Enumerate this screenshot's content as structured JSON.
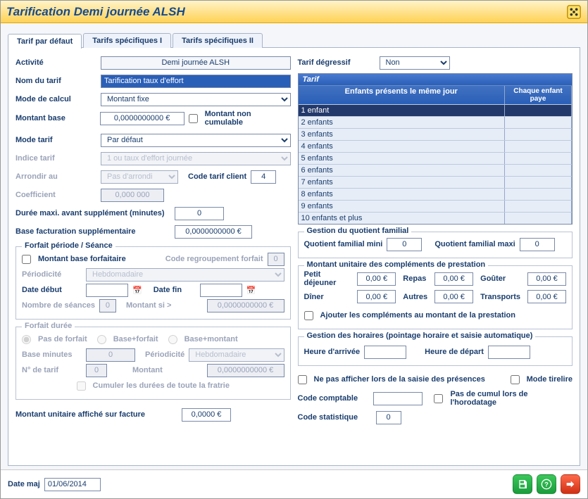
{
  "window": {
    "title": "Tarification Demi journée ALSH"
  },
  "tabs": [
    {
      "label": "Tarif par défaut"
    },
    {
      "label": "Tarifs spécifiques I"
    },
    {
      "label": "Tarifs spécifiques II"
    }
  ],
  "left": {
    "activite_label": "Activité",
    "activite_value": "Demi journée ALSH",
    "nom_tarif_label": "Nom du tarif",
    "nom_tarif_value": "Tarification taux d'effort",
    "mode_calcul_label": "Mode de calcul",
    "mode_calcul_value": "Montant fixe",
    "montant_base_label": "Montant base",
    "montant_base_value": "0,0000000000 €",
    "non_cumulable_label": "Montant non cumulable",
    "mode_tarif_label": "Mode tarif",
    "mode_tarif_value": "Par défaut",
    "indice_label": "Indice tarif",
    "indice_value": "1 ou taux d'effort journée",
    "arrondi_label": "Arrondir au",
    "arrondi_value": "Pas d'arrondi",
    "code_tarif_label": "Code tarif client",
    "code_tarif_value": "4",
    "coeff_label": "Coefficient",
    "coeff_value": "0,000 000",
    "duree_max_label": "Durée maxi. avant supplément (minutes)",
    "duree_max_value": "0",
    "base_supp_label": "Base facturation supplémentaire",
    "base_supp_value": "0,0000000000 €",
    "unitaire_label": "Montant unitaire affiché sur facture",
    "unitaire_value": "0,0000 €"
  },
  "fp": {
    "legend": "Forfait période / Séance",
    "base_forf_label": "Montant base forfaitaire",
    "regroup_label": "Code regroupement forfait",
    "regroup_value": "0",
    "period_label": "Périodicité",
    "period_value": "Hebdomadaire",
    "date_debut_label": "Date début",
    "date_fin_label": "Date fin",
    "nb_seances_label": "Nombre de séances",
    "nb_seances_value": "0",
    "montant_si_label": "Montant si >",
    "montant_si_value": "0,0000000000 €"
  },
  "fd": {
    "legend": "Forfait durée",
    "r1": "Pas de forfait",
    "r2": "Base+forfait",
    "r3": "Base+montant",
    "base_min_label": "Base minutes",
    "base_min_value": "0",
    "period_label": "Périodicité",
    "period_value": "Hebdomadaire",
    "no_tarif_label": "N° de tarif",
    "no_tarif_value": "0",
    "montant_label": "Montant",
    "montant_value": "0,0000000000 €",
    "cumuler_label": "Cumuler les durées de toute la fratrie"
  },
  "right": {
    "degressif_label": "Tarif dégressif",
    "degressif_value": "Non",
    "table": {
      "title": "Tarif",
      "col1": "Enfants présents le même jour",
      "col2": "Chaque enfant paye",
      "rows": [
        "1 enfant",
        "2 enfants",
        "3 enfants",
        "4 enfants",
        "5 enfants",
        "6 enfants",
        "7 enfants",
        "8 enfants",
        "9 enfants",
        "10 enfants et plus"
      ]
    }
  },
  "qf": {
    "legend": "Gestion du quotient familial",
    "mini_label": "Quotient familial mini",
    "mini_value": "0",
    "maxi_label": "Quotient familial maxi",
    "maxi_value": "0"
  },
  "comp": {
    "legend": "Montant unitaire des compléments de prestation",
    "petit_dej": "Petit déjeuner",
    "repas": "Repas",
    "gouter": "Goûter",
    "diner": "Dîner",
    "autres": "Autres",
    "transports": "Transports",
    "zero": "0,00 €",
    "ajouter_label": "Ajouter les compléments au montant de la prestation"
  },
  "horaires": {
    "legend": "Gestion des horaires (pointage horaire et saisie automatique)",
    "arrivee_label": "Heure d'arrivée",
    "depart_label": "Heure de départ"
  },
  "bottom": {
    "ne_pas_afficher": "Ne pas afficher lors de la saisie des présences",
    "mode_tirelire": "Mode tirelire",
    "code_comptable_label": "Code comptable",
    "pas_cumul": "Pas de cumul lors de l'horodatage",
    "code_stat_label": "Code statistique",
    "code_stat_value": "0"
  },
  "footer": {
    "date_maj_label": "Date maj",
    "date_maj_value": "01/06/2014"
  }
}
